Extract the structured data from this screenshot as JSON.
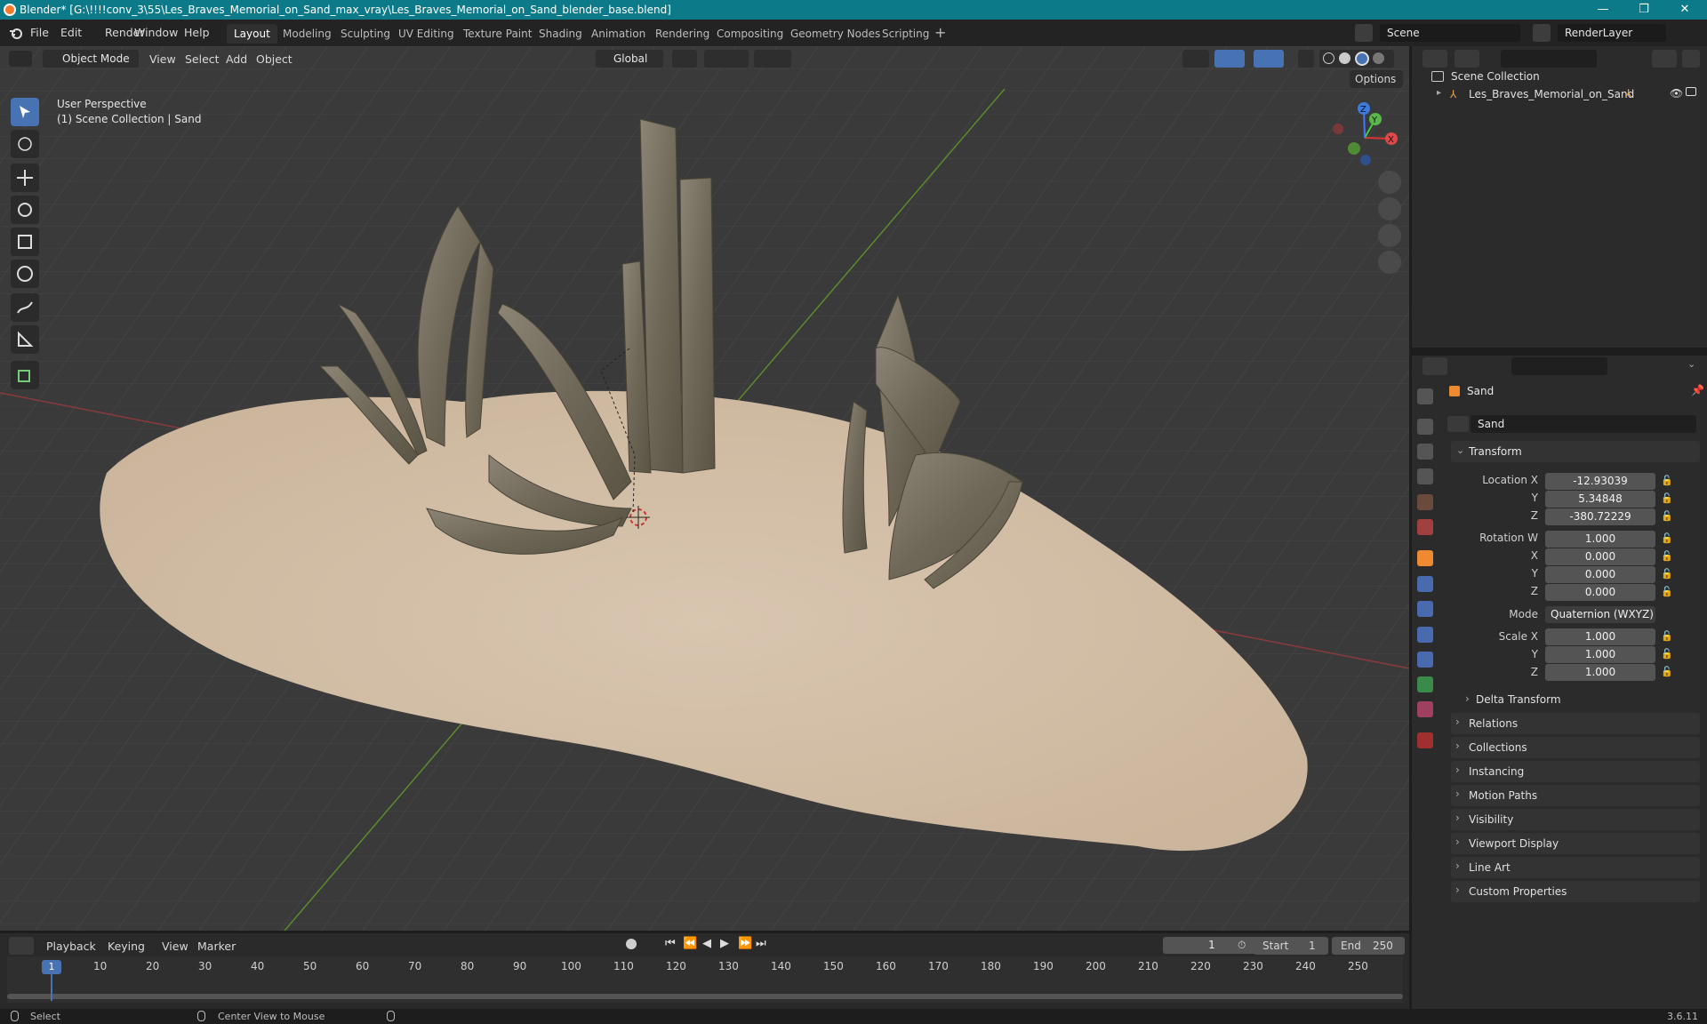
{
  "window": {
    "title": "Blender* [G:\\!!!!conv_3\\55\\Les_Braves_Memorial_on_Sand_max_vray\\Les_Braves_Memorial_on_Sand_blender_base.blend]",
    "minimize": "—",
    "maximize": "❐",
    "close": "✕"
  },
  "menu": [
    "File",
    "Edit",
    "Render",
    "Window",
    "Help"
  ],
  "workspaces": [
    "Layout",
    "Modeling",
    "Sculpting",
    "UV Editing",
    "Texture Paint",
    "Shading",
    "Animation",
    "Rendering",
    "Compositing",
    "Geometry Nodes",
    "Scripting"
  ],
  "active_workspace": "Layout",
  "scene_name": "Scene",
  "render_layer": "RenderLayer",
  "viewport": {
    "mode": "Object Mode",
    "menus": [
      "View",
      "Select",
      "Add",
      "Object"
    ],
    "orientation": "Global",
    "options": "Options",
    "overlay_line1": "User Perspective",
    "overlay_line2": "(1) Scene Collection | Sand",
    "axes": {
      "x": "X",
      "y": "Y",
      "z": "Z"
    }
  },
  "outliner": {
    "root": "Scene Collection",
    "items": [
      "Les_Braves_Memorial_on_Sand"
    ]
  },
  "properties": {
    "object_name": "Sand",
    "data_name": "Sand",
    "transform_title": "Transform",
    "location_label": "Location X",
    "location": {
      "x": "-12.93039",
      "y": "5.34848",
      "z": "-380.72229"
    },
    "rotation_label": "Rotation W",
    "rotation": {
      "w": "1.000",
      "x": "0.000",
      "y": "0.000",
      "z": "0.000"
    },
    "mode_label": "Mode",
    "mode_value": "Quaternion (WXYZ)",
    "scale_label": "Scale X",
    "scale": {
      "x": "1.000",
      "y": "1.000",
      "z": "1.000"
    },
    "axis_labels": {
      "x": "X",
      "y": "Y",
      "z": "Z"
    },
    "delta": "Delta Transform",
    "panels": [
      "Relations",
      "Collections",
      "Instancing",
      "Motion Paths",
      "Visibility",
      "Viewport Display",
      "Line Art",
      "Custom Properties"
    ]
  },
  "timeline": {
    "menus": [
      "Playback",
      "Keying",
      "View",
      "Marker"
    ],
    "current_frame": "1",
    "start_label": "Start",
    "start": "1",
    "end_label": "End",
    "end": "250",
    "ticks": [
      "10",
      "20",
      "30",
      "40",
      "50",
      "60",
      "70",
      "80",
      "90",
      "100",
      "110",
      "120",
      "130",
      "140",
      "150",
      "160",
      "170",
      "180",
      "190",
      "200",
      "210",
      "220",
      "230",
      "240",
      "250"
    ],
    "playhead_label": "1"
  },
  "status": {
    "select": "Select",
    "center": "Center View to Mouse",
    "version": "3.6.11"
  },
  "colors": {
    "titlebar": "#0d7a8a",
    "accent": "#4772b3",
    "sand": "#d8c6b0"
  }
}
